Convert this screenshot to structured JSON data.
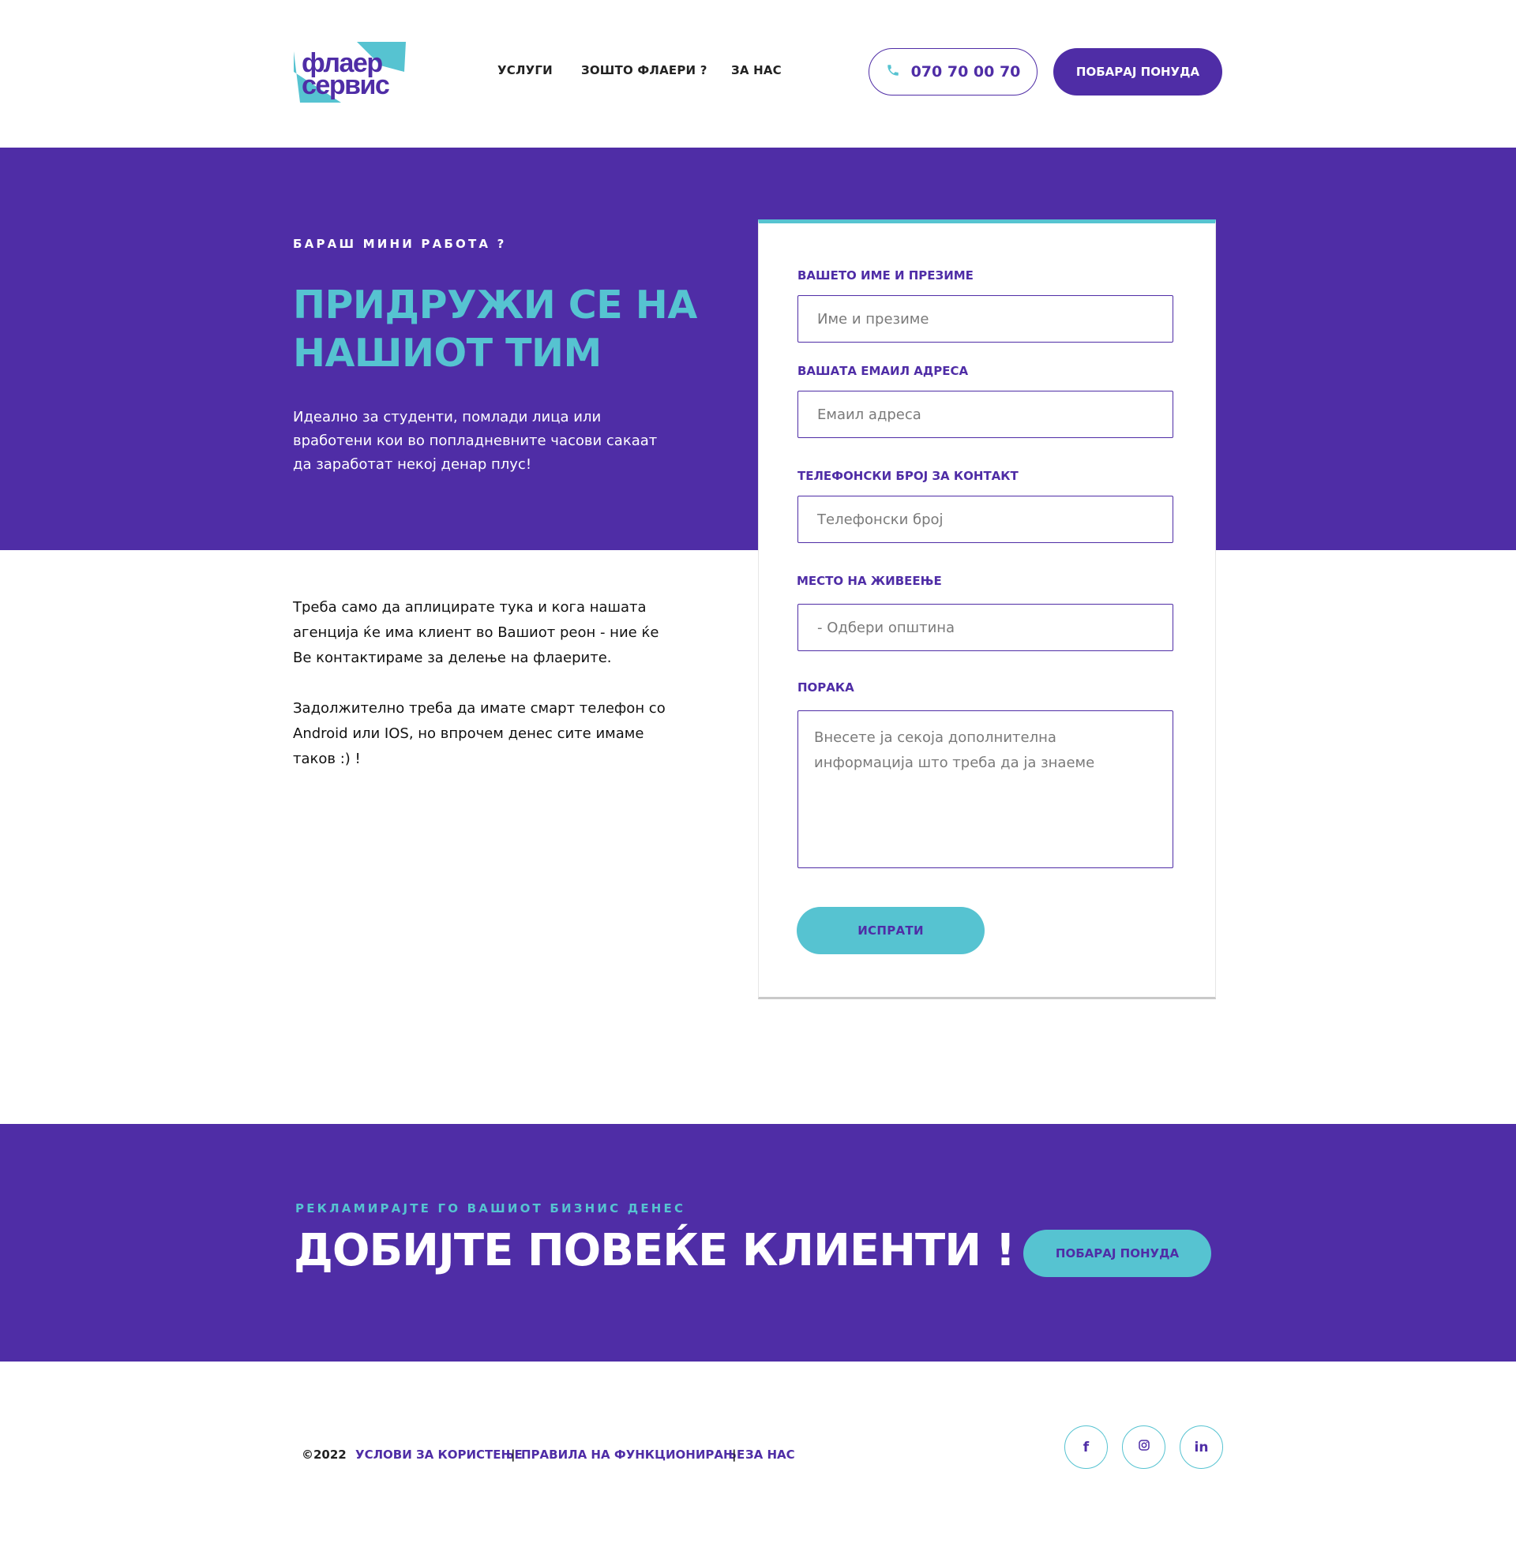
{
  "brand": {
    "logo_line1": "флаер",
    "logo_line2": "сервис",
    "primary_color": "#4f2da6",
    "accent_color": "#56c3d1"
  },
  "nav": {
    "items": [
      {
        "label": "УСЛУГИ"
      },
      {
        "label": "ЗОШТО ФЛАЕРИ ?"
      },
      {
        "label": "ЗА НАС"
      }
    ],
    "phone": "070 70 00 70",
    "phone_icon": "phone-icon",
    "quote_button": "ПОБАРАЈ ПОНУДА"
  },
  "hero": {
    "kicker": "БАРАШ МИНИ РАБОТА ?",
    "title": "ПРИДРУЖИ СЕ НА НАШИОТ ТИМ",
    "description": "Идеално за студенти, помлади лица или вработени кои во попладневните часови сакаат да заработат некој денар плус!"
  },
  "body": {
    "paragraph1": "Треба само да аплицирате тука и кога нашата агенција ќе има клиент во Вашиот реон - ние ќе Ве контактираме за делење на флаерите.",
    "paragraph2": "Задолжително треба да имате смарт телефон со Android или IOS, но впрочем денес сите имаме таков :) !"
  },
  "form": {
    "name_label": "ВАШЕТО ИМЕ И ПРЕЗИМЕ",
    "name_placeholder": "Име и презиме",
    "email_label": "ВАШАТА ЕМАИЛ АДРЕСА",
    "email_placeholder": "Емаил адреса",
    "phone_label": "ТЕЛЕФОНСКИ БРОЈ ЗА КОНТАКТ",
    "phone_placeholder": "Телефонски број",
    "city_label": "МЕСТО НА ЖИВЕЕЊЕ",
    "city_selected": "- Одбери општина",
    "message_label": "ПОРАКА",
    "message_placeholder": "Внесете ја секоја дополнителна информација што треба да ја знаеме",
    "submit": "ИСПРАТИ"
  },
  "cta": {
    "kicker": "РЕКЛАМИРАЈТЕ ГО ВАШИОТ БИЗНИС ДЕНЕС",
    "title": "ДОБИЈТЕ ПОВЕЌЕ КЛИЕНТИ !",
    "button": "ПОБАРАЈ ПОНУДА"
  },
  "footer": {
    "copyright": "©2022",
    "links": [
      "УСЛОВИ ЗА КОРИСТЕЊЕ",
      "ПРАВИЛА НА ФУНКЦИОНИРАЊЕ",
      "ЗА НАС"
    ],
    "separator": "|",
    "social": [
      {
        "icon": "facebook-icon",
        "glyph": "f"
      },
      {
        "icon": "instagram-icon"
      },
      {
        "icon": "linkedin-icon",
        "glyph": "in"
      }
    ]
  }
}
